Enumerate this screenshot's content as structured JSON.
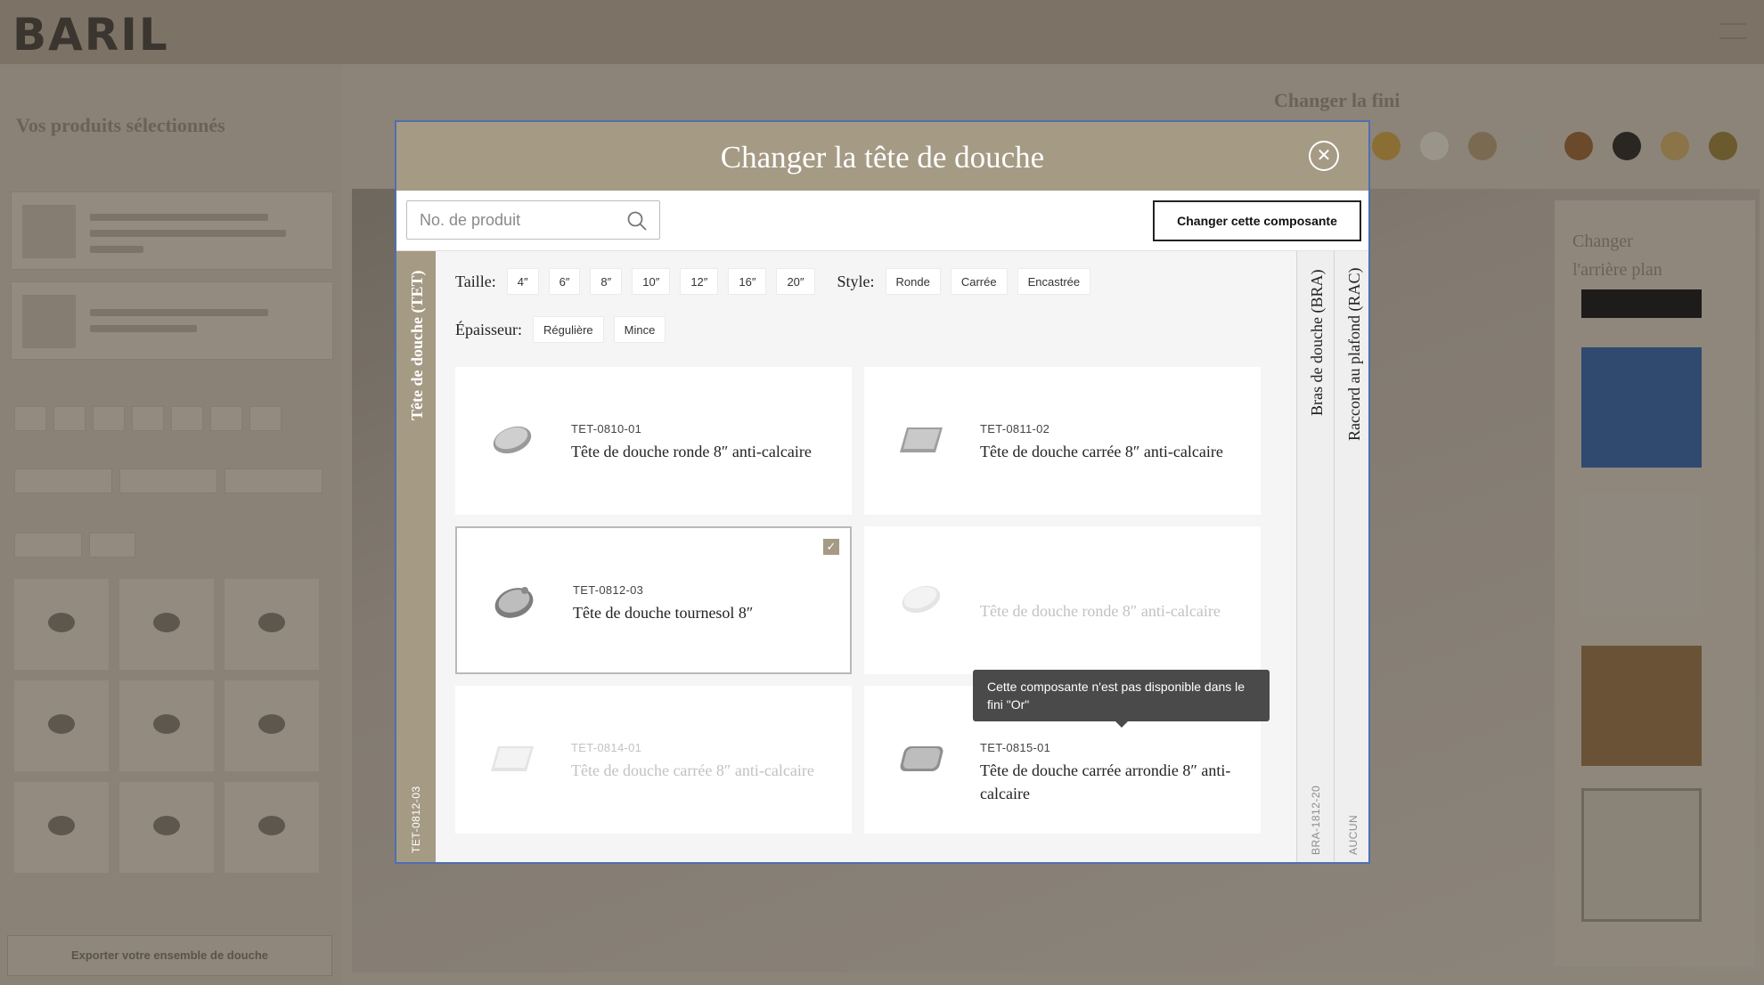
{
  "background": {
    "brand": "BARIL",
    "sidebar_title": "Vos produits sélectionnés",
    "finish_title": "Changer la fini",
    "panel_title": "Changer l'arrière plan",
    "export_label": "Exporter votre ensemble de douche",
    "swatch_colors": [
      "#8a6e34",
      "#9a958a",
      "#7a6a52",
      "#8a857b",
      "#6a4a2a",
      "#2a2622",
      "#8a7448",
      "#6a5a2e"
    ]
  },
  "modal": {
    "title": "Changer la tête de douche",
    "close_icon": "close-icon",
    "search": {
      "placeholder": "No. de produit",
      "value": ""
    },
    "change_button": "Changer cette composante",
    "active_tab": {
      "label": "Tête de douche (TET)",
      "code": "TET-0812-03"
    },
    "side_tabs": [
      {
        "label": "Bras de douche (BRA)",
        "code": "BRA-1812-20"
      },
      {
        "label": "Raccord au plafond (RAC)",
        "code": "AUCUN"
      }
    ],
    "filters": {
      "size": {
        "label": "Taille:",
        "options": [
          "4″",
          "6″",
          "8″",
          "10″",
          "12″",
          "16″",
          "20″"
        ]
      },
      "style": {
        "label": "Style:",
        "options": [
          "Ronde",
          "Carrée",
          "Encastrée"
        ]
      },
      "thickness": {
        "label": "Épaisseur:",
        "options": [
          "Régulière",
          "Mince"
        ]
      }
    },
    "products": [
      {
        "sku": "TET-0810-01",
        "name": "Tête de douche ronde 8″ anti-calcaire",
        "state": "available",
        "icon": "round-showerhead-icon"
      },
      {
        "sku": "TET-0811-02",
        "name": "Tête de douche carrée 8″ anti-calcaire",
        "state": "available",
        "icon": "square-showerhead-icon"
      },
      {
        "sku": "TET-0812-03",
        "name": "Tête de douche tournesol 8″",
        "state": "selected",
        "icon": "sunflower-showerhead-icon"
      },
      {
        "sku": "",
        "name": "Tête de douche ronde 8″ anti-calcaire",
        "state": "unavailable",
        "icon": "round-showerhead-icon"
      },
      {
        "sku": "TET-0814-01",
        "name": "Tête de douche carrée 8″ anti-calcaire",
        "state": "unavailable",
        "icon": "square-showerhead-icon"
      },
      {
        "sku": "TET-0815-01",
        "name": "Tête de douche carrée arrondie 8″ anti-calcaire",
        "state": "available",
        "icon": "rounded-square-showerhead-icon"
      }
    ],
    "tooltip": "Cette composante n'est pas disponible dans le fini \"Or\""
  }
}
